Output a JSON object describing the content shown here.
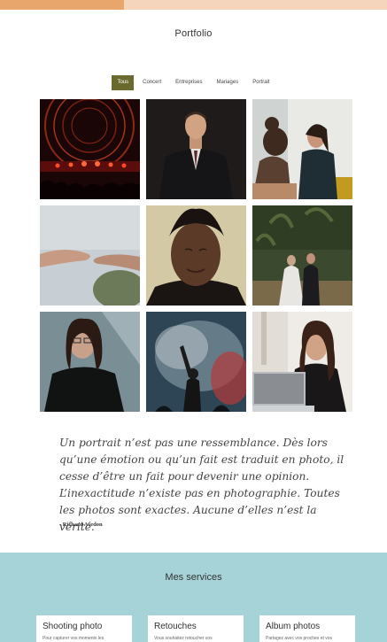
{
  "header": {
    "title": "Portfolio"
  },
  "filters": [
    {
      "label": "Tous",
      "active": true
    },
    {
      "label": "Concert",
      "active": false
    },
    {
      "label": "Entreprises",
      "active": false
    },
    {
      "label": "Mariages",
      "active": false
    },
    {
      "label": "Portrait",
      "active": false
    }
  ],
  "gallery": [
    {
      "subject": "concert-stage-lights"
    },
    {
      "subject": "man-in-suit"
    },
    {
      "subject": "business-handshake-meeting"
    },
    {
      "subject": "reaching-hands"
    },
    {
      "subject": "man-eyes-closed-portrait"
    },
    {
      "subject": "wedding-couple-palms"
    },
    {
      "subject": "woman-glasses-portrait"
    },
    {
      "subject": "concert-crowd-smoke"
    },
    {
      "subject": "woman-laughing-laptop"
    }
  ],
  "quote": {
    "lines": [
      "Un portrait n’est pas une ressemblance. Dès lors",
      "qu’une émotion ou qu’un fait est traduit en photo, il",
      "cesse d’être un fait pour devenir une opinion.",
      "L’inexactitude n’existe pas en photographie. Toutes",
      "les photos sont exactes. Aucune d’elles n’est la vérité."
    ],
    "author": "- Richard Avedon"
  },
  "services": {
    "title": "Mes services",
    "cards": [
      {
        "title": "Shooting photo",
        "text": "Pour capturer vos moments les"
      },
      {
        "title": "Retouches",
        "text": "Vous souhaitez retoucher vos"
      },
      {
        "title": "Album photos",
        "text": "Partagez avec vos proches et vos"
      }
    ]
  },
  "colors": {
    "accent": "#6b6a2e",
    "topbar_primary": "#e8a56c",
    "topbar_secondary": "#f5d5bb",
    "services_bg": "#a6d3d7"
  }
}
